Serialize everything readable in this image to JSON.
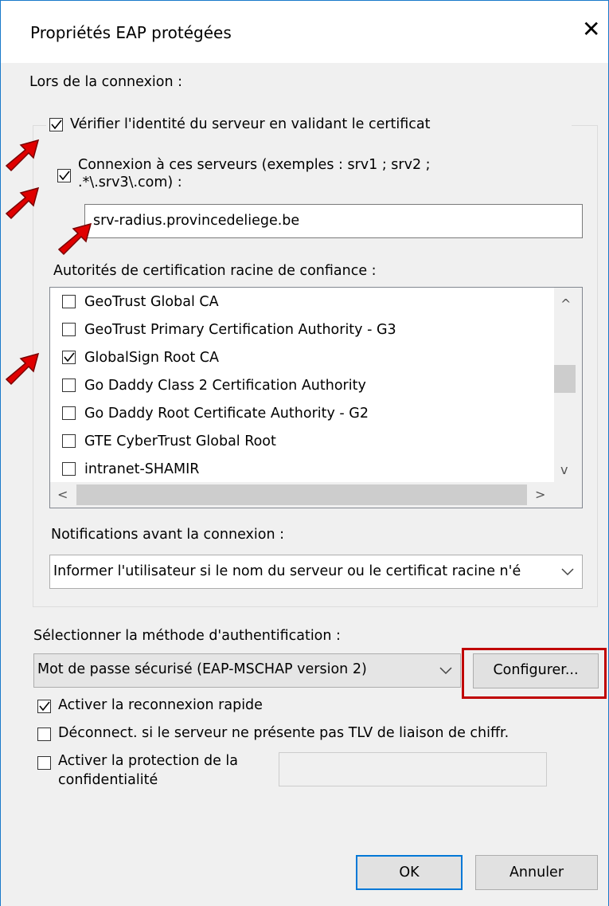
{
  "dialog": {
    "title": "Propriétés EAP protégées",
    "close_label": "✕"
  },
  "connection": {
    "heading": "Lors de la connexion :",
    "verify_cert_label": "Vérifier l'identité du serveur en validant le certificat",
    "verify_cert_checked": true,
    "connect_servers_label_line1": "Connexion à ces serveurs (exemples : srv1 ; srv2 ;",
    "connect_servers_label_line2": ".*\\.srv3\\.com) :",
    "connect_servers_checked": true,
    "server_value": "srv-radius.provincedeliege.be",
    "ca_heading": "Autorités de certification racine de confiance :",
    "ca_list": [
      {
        "label": "GeoTrust Global CA",
        "checked": false
      },
      {
        "label": "GeoTrust Primary Certification Authority - G3",
        "checked": false
      },
      {
        "label": "GlobalSign Root CA",
        "checked": true
      },
      {
        "label": "Go Daddy Class 2 Certification Authority",
        "checked": false
      },
      {
        "label": "Go Daddy Root Certificate Authority - G2",
        "checked": false
      },
      {
        "label": "GTE CyberTrust Global Root",
        "checked": false
      },
      {
        "label": "intranet-SHAMIR",
        "checked": false
      }
    ],
    "notifications_heading": "Notifications avant la connexion :",
    "notifications_value": "Informer l'utilisateur si le nom du serveur ou le certificat racine n'é"
  },
  "auth": {
    "heading": "Sélectionner la méthode d'authentification :",
    "method_value": "Mot de passe sécurisé (EAP-MSCHAP version 2)",
    "configure_label": "Configurer...",
    "fast_reconnect_label": "Activer la reconnexion rapide",
    "fast_reconnect_checked": true,
    "disconnect_tlv_label": "Déconnect. si le serveur ne présente pas TLV de liaison de chiffr.",
    "disconnect_tlv_checked": false,
    "privacy_label_line1": "Activer la protection de la",
    "privacy_label_line2": "confidentialité",
    "privacy_checked": false,
    "privacy_value": ""
  },
  "footer": {
    "ok_label": "OK",
    "cancel_label": "Annuler"
  },
  "colors": {
    "accent": "#0078d7",
    "highlight_box": "#c00000",
    "arrow_fill": "#e00000"
  }
}
